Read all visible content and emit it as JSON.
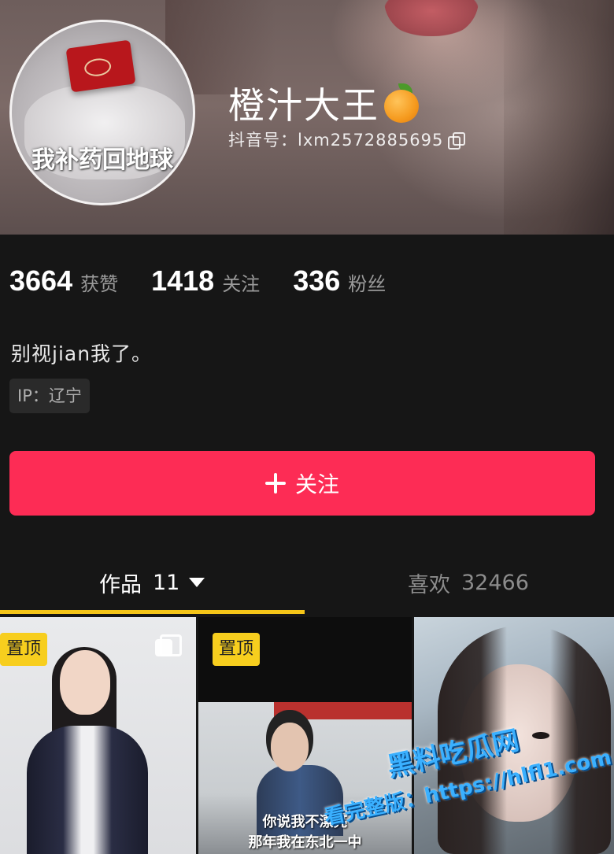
{
  "profile": {
    "avatar_caption": "我补药回地球",
    "nickname": "橙汁大王",
    "douyin_id": "抖音号：lxm2572885695",
    "bio": "别视jian我了。",
    "ip_location": "IP：辽宁"
  },
  "stats": [
    {
      "value": "3664",
      "label": "获赞"
    },
    {
      "value": "1418",
      "label": "关注"
    },
    {
      "value": "336",
      "label": "粉丝"
    }
  ],
  "follow_button": {
    "label": "关注",
    "color": "#fd2c55"
  },
  "tabs": {
    "works": {
      "label": "作品",
      "count": "11"
    },
    "likes": {
      "label": "喜欢",
      "count": "32466"
    }
  },
  "videos": [
    {
      "pinned": true,
      "pin_label": "置顶",
      "multi_image": true
    },
    {
      "pinned": true,
      "pin_label": "置顶",
      "subtitle_line1": "你说我不漂亮",
      "subtitle_line2": "那年我在东北一中"
    },
    {
      "pinned": false
    }
  ],
  "watermark": {
    "line1": "黑料吃瓜网",
    "line2": "看完整版：https://hlfl1.com"
  },
  "colors": {
    "background": "#161616",
    "accent": "#fd2c55",
    "tab_indicator": "#f5c518",
    "pin_badge": "#f7ce1e"
  }
}
